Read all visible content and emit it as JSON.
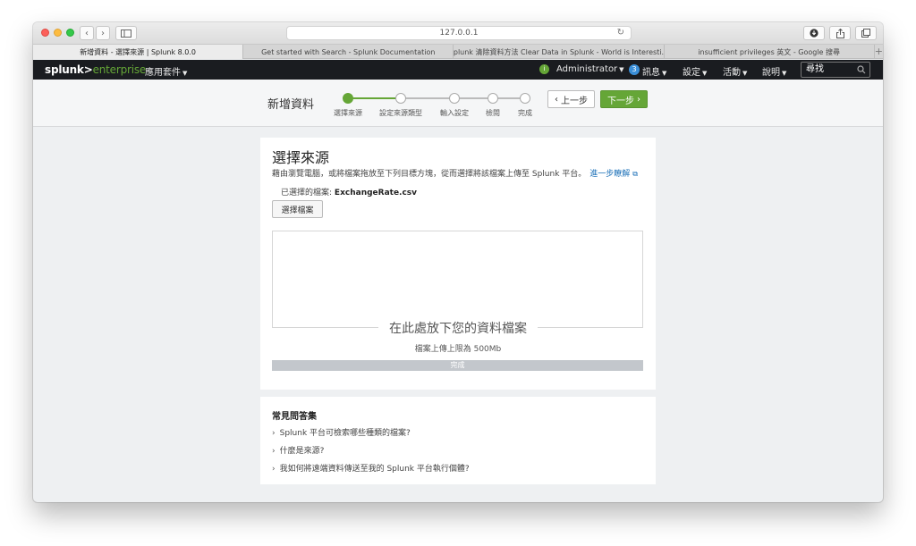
{
  "browser": {
    "address": "127.0.0.1",
    "tabs": [
      {
        "label": "新增資料 - 選擇來源 | Splunk 8.0.0",
        "active": true
      },
      {
        "label": "Get started with Search - Splunk Documentation",
        "active": false
      },
      {
        "label": "Splunk 清除資料方法 Clear Data in Splunk - World is Interesti...",
        "active": false
      },
      {
        "label": "insufficient privileges 英文 - Google 搜尋",
        "active": false
      }
    ],
    "new_tab": "+"
  },
  "header": {
    "logo_brand": "splunk>",
    "logo_product": "enterprise",
    "apps_menu": "應用套件",
    "user_status_icon": "i",
    "user": "Administrator",
    "messages_count": "3",
    "messages": "訊息",
    "settings": "設定",
    "activity": "活動",
    "help": "說明",
    "search_placeholder": "尋找"
  },
  "wizard": {
    "title": "新增資料",
    "steps": [
      "選擇來源",
      "設定來源類型",
      "輸入設定",
      "檢閱",
      "完成"
    ],
    "current_step": 1,
    "prev_label": "上一步",
    "next_label": "下一步"
  },
  "source": {
    "title": "選擇來源",
    "description": "藉由瀏覽電腦，或將檔案拖放至下列目標方塊，從而選擇將該檔案上傳至 Splunk 平台。",
    "learn_more": "進一步瞭解",
    "selected_label": "已選擇的檔案:",
    "selected_file": "ExchangeRate.csv",
    "choose_button": "選擇檔案",
    "drop_title": "在此處放下您的資料檔案",
    "upload_limit": "檔案上傳上限為 500Mb",
    "progress_label": "完成",
    "progress": 1.0
  },
  "faq": {
    "title": "常見問答集",
    "items": [
      "Splunk 平台可檢索哪些種類的檔案?",
      "什麼是來源?",
      "我如何將遠端資料傳送至我的 Splunk 平台執行個體?"
    ]
  },
  "colors": {
    "accent": "#65a637",
    "header_bg": "#1a1c20",
    "link": "#1a6fb7"
  }
}
